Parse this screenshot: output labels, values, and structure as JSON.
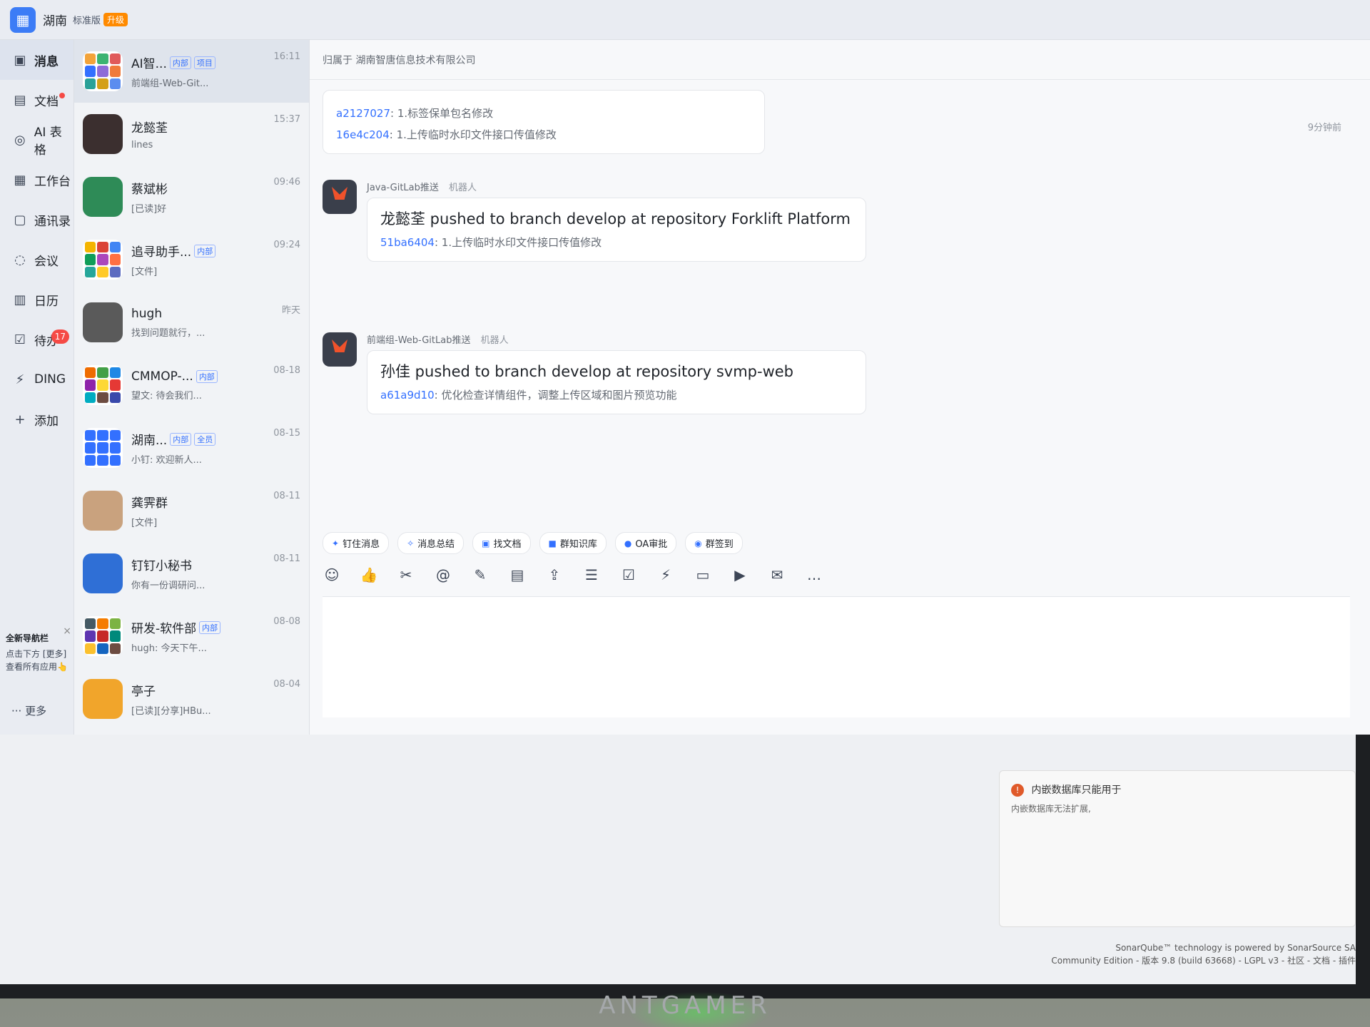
{
  "topbar": {
    "org_short": "湖南",
    "org_name": "湖南智唐信息技术有限公司",
    "edition": "标准版",
    "upgrade": "升级"
  },
  "sidebar": {
    "items": [
      {
        "label": "消息",
        "icon": "message-icon",
        "glyph": "▣"
      },
      {
        "label": "文档",
        "icon": "doc-icon",
        "glyph": "▤"
      },
      {
        "label": "AI 表格",
        "icon": "ai-table-icon",
        "glyph": "◎"
      },
      {
        "label": "工作台",
        "icon": "workbench-icon",
        "glyph": "▦"
      },
      {
        "label": "通讯录",
        "icon": "contacts-icon",
        "glyph": "▢"
      },
      {
        "label": "会议",
        "icon": "meeting-icon",
        "glyph": "◌"
      },
      {
        "label": "日历",
        "icon": "calendar-icon",
        "glyph": "▥"
      },
      {
        "label": "待办",
        "icon": "todo-icon",
        "glyph": "☑"
      },
      {
        "label": "DING",
        "icon": "ding-icon",
        "glyph": "⚡"
      },
      {
        "label": "添加",
        "icon": "add-icon",
        "glyph": "+"
      }
    ],
    "todo_count": "17",
    "tip_title": "全新导航栏",
    "tip_text": "点击下方 [更多] 查看所有应用👆",
    "more_label": "··· 更多"
  },
  "conversations": [
    {
      "title": "AI智...",
      "tags": [
        "内部",
        "项目"
      ],
      "sub": "前端组-Web-Git...",
      "time": "16:11",
      "colors": [
        "#f2a33a",
        "#3cb371",
        "#e05a5a",
        "#3370ff",
        "#8e6bd8",
        "#f07a3a",
        "#2aa198",
        "#d4a017",
        "#5b8def"
      ]
    },
    {
      "title": "龙懿荃",
      "tags": [],
      "sub": "lines",
      "time": "15:37",
      "colors": [
        "#3b2f2f"
      ]
    },
    {
      "title": "蔡斌彬",
      "tags": [],
      "sub": "[已读]好",
      "time": "09:46",
      "colors": [
        "#2e8b57"
      ]
    },
    {
      "title": "追寻助手...",
      "tags": [
        "内部"
      ],
      "sub": "[文件]",
      "time": "09:24",
      "colors": [
        "#f4b400",
        "#db4437",
        "#4285f4",
        "#0f9d58",
        "#ab47bc",
        "#ff7043",
        "#26a69a",
        "#ffca28",
        "#5c6bc0"
      ]
    },
    {
      "title": "hugh",
      "tags": [],
      "sub": "找到问题就行，...",
      "time": "昨天",
      "colors": [
        "#5a5a5a"
      ]
    },
    {
      "title": "CMMOP-...",
      "tags": [
        "内部"
      ],
      "sub": "望文: 待会我们...",
      "time": "08-18",
      "colors": [
        "#ef6c00",
        "#43a047",
        "#1e88e5",
        "#8e24aa",
        "#fdd835",
        "#e53935",
        "#00acc1",
        "#6d4c41",
        "#3949ab"
      ]
    },
    {
      "title": "湖南...",
      "tags": [
        "内部",
        "全员"
      ],
      "sub": "小钉: 欢迎新人...",
      "time": "08-15",
      "colors": [
        "#3370ff",
        "#3370ff",
        "#3370ff",
        "#3370ff",
        "#3370ff",
        "#3370ff",
        "#3370ff",
        "#3370ff",
        "#3370ff"
      ]
    },
    {
      "title": "龚霁群",
      "tags": [],
      "sub": "[文件]",
      "time": "08-11",
      "colors": [
        "#c9a27e"
      ]
    },
    {
      "title": "钉钉小秘书",
      "tags": [],
      "sub": "你有一份调研问...",
      "time": "08-11",
      "colors": [
        "#2f6fd6"
      ]
    },
    {
      "title": "研发-软件部",
      "tags": [
        "内部"
      ],
      "sub": "hugh: 今天下午...",
      "time": "08-08",
      "colors": [
        "#455a64",
        "#f57c00",
        "#7cb342",
        "#5e35b1",
        "#c62828",
        "#00897b",
        "#fbc02d",
        "#1565c0",
        "#6d4c41"
      ]
    },
    {
      "title": "亭子",
      "tags": [],
      "sub": "[已读][分享]HBu...",
      "time": "08-04",
      "colors": [
        "#f1a52b"
      ]
    }
  ],
  "chat": {
    "header": "归属于 湖南智唐信息技术有限公司",
    "msg1": {
      "hash1": "a2127027",
      "text1": ": 1.标签保单包名修改",
      "hash2": "16e4c204",
      "text2": ": 1.上传临时水印文件接口传值修改",
      "time": "9分钟前"
    },
    "msg2": {
      "sender": "Java-GitLab推送",
      "robot": "机器人",
      "title": "龙懿荃 pushed to branch develop at repository Forklift Platform",
      "hash": "51ba6404",
      "text": ": 1.上传临时水印文件接口传值修改"
    },
    "msg3": {
      "sender": "前端组-Web-GitLab推送",
      "robot": "机器人",
      "title": "孙佳 pushed to branch develop at repository svmp-web",
      "hash": "a61a9d10",
      "text": ": 优化检查详情组件，调整上传区域和图片预览功能"
    },
    "quick_actions": [
      {
        "label": "钉住消息",
        "icon": "pin-icon",
        "glyph": "✦"
      },
      {
        "label": "消息总结",
        "icon": "summary-icon",
        "glyph": "✧"
      },
      {
        "label": "找文档",
        "icon": "find-doc-icon",
        "glyph": "▣"
      },
      {
        "label": "群知识库",
        "icon": "knowledge-icon",
        "glyph": "■"
      },
      {
        "label": "OA审批",
        "icon": "oa-icon",
        "glyph": "●"
      },
      {
        "label": "群签到",
        "icon": "checkin-icon",
        "glyph": "◉"
      }
    ],
    "toolbar": [
      {
        "icon": "emoji-icon",
        "glyph": "☺"
      },
      {
        "icon": "like-icon",
        "glyph": "👍"
      },
      {
        "icon": "scissors-icon",
        "glyph": "✂"
      },
      {
        "icon": "at-icon",
        "glyph": "@"
      },
      {
        "icon": "edit-icon",
        "glyph": "✎"
      },
      {
        "icon": "file-icon",
        "glyph": "▤"
      },
      {
        "icon": "upload-icon",
        "glyph": "⇪"
      },
      {
        "icon": "list-icon",
        "glyph": "☰"
      },
      {
        "icon": "task-icon",
        "glyph": "☑"
      },
      {
        "icon": "flash-icon",
        "glyph": "⚡"
      },
      {
        "icon": "video-icon",
        "glyph": "▭"
      },
      {
        "icon": "live-icon",
        "glyph": "▶"
      },
      {
        "icon": "mail-icon",
        "glyph": "✉"
      },
      {
        "icon": "more-icon",
        "glyph": "…"
      }
    ]
  },
  "toast": {
    "title": "内嵌数据库只能用于",
    "sub": "内嵌数据库无法扩展,"
  },
  "footer": {
    "line1": "SonarQube™ technology is powered by SonarSource SA",
    "line2": "Community Edition - 版本 9.8 (build 63668) - LGPL v3 - 社区 - 文档 - 插件"
  },
  "monitor_brand": "ANTGAMER"
}
